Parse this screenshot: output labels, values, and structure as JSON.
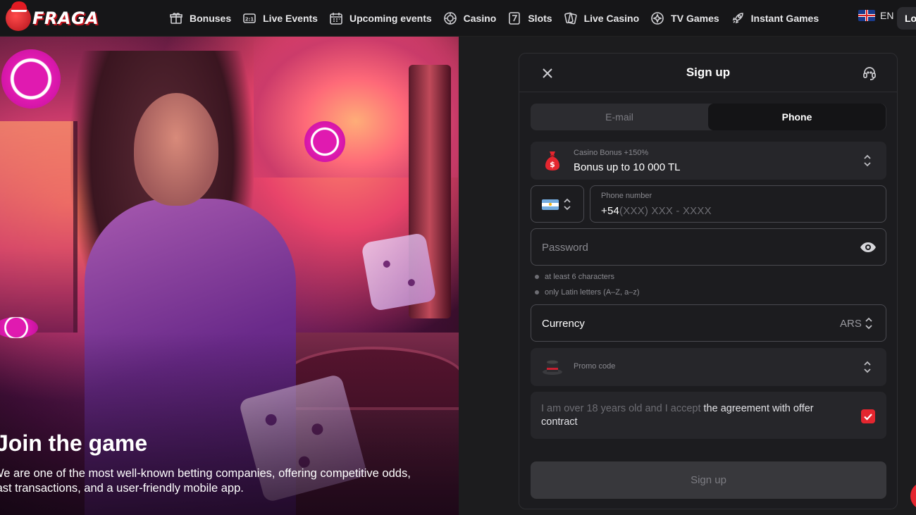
{
  "brand": {
    "name": "FRAGA"
  },
  "nav": {
    "items": [
      {
        "label": "Bonuses",
        "icon": "gift-icon"
      },
      {
        "label": "Live Events",
        "icon": "scoreboard-icon"
      },
      {
        "label": "Upcoming events",
        "icon": "calendar-icon"
      },
      {
        "label": "Casino",
        "icon": "chip-icon"
      },
      {
        "label": "Slots",
        "icon": "slot-seven-icon"
      },
      {
        "label": "Live Casino",
        "icon": "cards-icon"
      },
      {
        "label": "TV Games",
        "icon": "sparkle-icon"
      },
      {
        "label": "Instant Games",
        "icon": "rocket-icon"
      }
    ],
    "language": "EN",
    "login_label": "Lo"
  },
  "hero": {
    "title": "Join the game",
    "description": "We are one of the most well-known betting companies, offering competitive odds, fast transactions, and a user-friendly mobile app."
  },
  "signup": {
    "title": "Sign up",
    "tabs": {
      "email": "E-mail",
      "phone": "Phone",
      "active": "Phone"
    },
    "bonus": {
      "caption": "Casino Bonus +150%",
      "value": "Bonus up to 10 000 TL"
    },
    "phone": {
      "label": "Phone number",
      "prefix": "+54",
      "mask": "(XXX) XXX - XXXX"
    },
    "password": {
      "placeholder": "Password"
    },
    "hints": [
      "at least 6 characters",
      "only Latin letters (A–Z, a–z)"
    ],
    "currency": {
      "label": "Currency",
      "value": "ARS"
    },
    "promo": {
      "label": "Promo code"
    },
    "agreement": {
      "text": "I am over 18 years old and I accept ",
      "link": "the agreement with offer contract",
      "checked": true
    },
    "submit_label": "Sign up"
  },
  "colors": {
    "accent": "#e4262f",
    "background": "#1c1c1e"
  }
}
